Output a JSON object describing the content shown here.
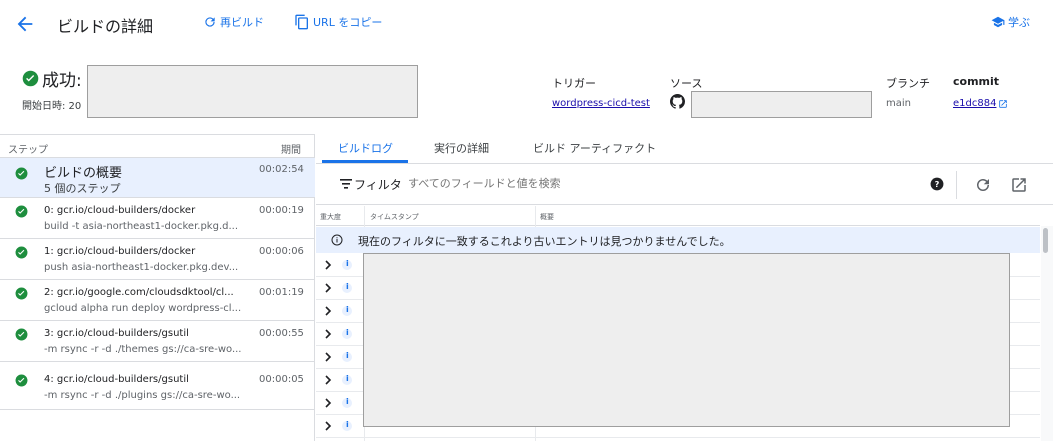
{
  "header": {
    "title": "ビルドの詳細",
    "rebuild_label": "再ビルド",
    "copy_url_label": "URL をコピー",
    "learn_label": "学ぶ"
  },
  "summary": {
    "status": "成功:",
    "start_date_label": "開始日時: 20",
    "trigger_label": "トリガー",
    "trigger_value": "wordpress-cicd-test",
    "source_label": "ソース",
    "branch_label": "ブランチ",
    "branch_value": "main",
    "commit_label": "commit",
    "commit_value": "e1dc884"
  },
  "steps": {
    "header_step": "ステップ",
    "header_duration": "期間",
    "items": [
      {
        "line1": "ビルドの概要",
        "line2": "5 個のステップ",
        "duration": "00:02:54"
      },
      {
        "line1": "0: gcr.io/cloud-builders/docker",
        "line2": "build -t asia-northeast1-docker.pkg.d...",
        "duration": "00:00:19"
      },
      {
        "line1": "1: gcr.io/cloud-builders/docker",
        "line2": "push asia-northeast1-docker.pkg.dev...",
        "duration": "00:00:06"
      },
      {
        "line1": "2: gcr.io/google.com/cloudsdktool/cl...",
        "line2": "gcloud alpha run deploy wordpress-cl...",
        "duration": "00:01:19"
      },
      {
        "line1": "3: gcr.io/cloud-builders/gsutil",
        "line2": "-m rsync -r -d ./themes gs://ca-sre-wo...",
        "duration": "00:00:55"
      },
      {
        "line1": "4: gcr.io/cloud-builders/gsutil",
        "line2": "-m rsync -r -d ./plugins gs://ca-sre-wo...",
        "duration": "00:00:05"
      }
    ]
  },
  "tabs": [
    "ビルドログ",
    "実行の詳細",
    "ビルド アーティファクト"
  ],
  "filter": {
    "label": "フィルタ",
    "placeholder": "すべてのフィールドと値を検索"
  },
  "log": {
    "col_severity": "重大度",
    "col_timestamp": "タイムスタンプ",
    "col_summary": "概要",
    "info_message": "現在のフィルタに一致するこれより古いエントリは見つかりませんでした。",
    "severity_glyph": "i"
  },
  "colors": {
    "accent": "#1a73e8",
    "success": "#1e8e3e",
    "selected_bg": "#e8f0fe"
  }
}
